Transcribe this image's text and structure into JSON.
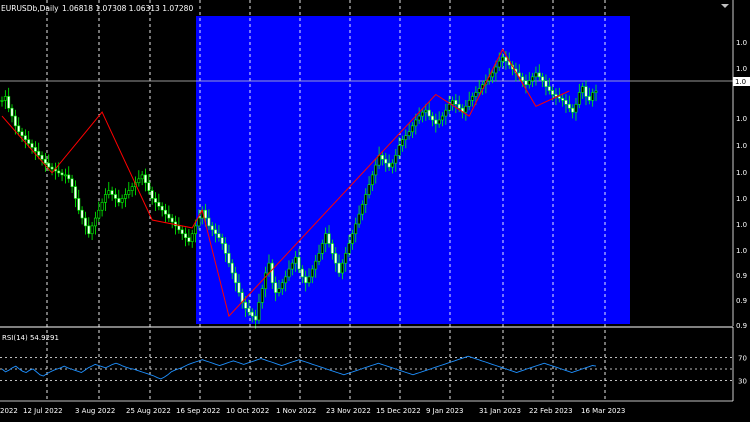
{
  "header": {
    "symbol_label": "EURUSDb,Daily",
    "ohlc_text": "1.06818 1.07308 1.06313 1.07280"
  },
  "indicator": {
    "label": "RSI(14) 54.9291",
    "levels": [
      70,
      50,
      30
    ]
  },
  "colors": {
    "background": "#000000",
    "candle": "#00ff00",
    "zigzag": "#ff0000",
    "selection_rect": "#0000ff",
    "rsi_line": "#1e90ff",
    "grid": "#ffffff",
    "axis_text": "#ffffff"
  },
  "chart_data": [
    {
      "type": "candlestick",
      "title": "EURUSDb,Daily",
      "x_ticks": [
        "2022",
        "12 Jul 2022",
        "3 Aug 2022",
        "25 Aug 2022",
        "16 Sep 2022",
        "10 Oct 2022",
        "1 Nov 2022",
        "23 Nov 2022",
        "15 Dec 2022",
        "9 Jan 2023",
        "31 Jan 2023",
        "22 Feb 2023",
        "16 Mar 2023"
      ],
      "close_series": [
        1.068,
        1.07,
        1.064,
        1.06,
        1.055,
        1.052,
        1.05,
        1.048,
        1.046,
        1.044,
        1.042,
        1.04,
        1.038,
        1.036,
        1.034,
        1.033,
        1.032,
        1.031,
        1.03,
        1.03,
        1.028,
        1.024,
        1.018,
        1.012,
        1.008,
        1.004,
        1.0,
        1.004,
        1.008,
        1.012,
        1.016,
        1.02,
        1.022,
        1.02,
        1.018,
        1.016,
        1.018,
        1.02,
        1.022,
        1.024,
        1.026,
        1.028,
        1.03,
        1.026,
        1.022,
        1.018,
        1.016,
        1.014,
        1.012,
        1.01,
        1.008,
        1.006,
        1.004,
        1.002,
        1.0,
        0.998,
        0.996,
        1.0,
        1.004,
        1.008,
        1.012,
        1.008,
        1.004,
        1.002,
        1.0,
        0.998,
        0.995,
        0.99,
        0.985,
        0.98,
        0.975,
        0.97,
        0.965,
        0.962,
        0.96,
        0.958,
        0.956,
        0.965,
        0.972,
        0.98,
        0.985,
        0.975,
        0.97,
        0.972,
        0.975,
        0.978,
        0.982,
        0.985,
        0.988,
        0.982,
        0.978,
        0.975,
        0.978,
        0.982,
        0.986,
        0.99,
        0.995,
        1.0,
        0.995,
        0.99,
        0.985,
        0.98,
        0.985,
        0.99,
        0.995,
        1.0,
        1.005,
        1.01,
        1.015,
        1.02,
        1.025,
        1.03,
        1.035,
        1.04,
        1.038,
        1.036,
        1.034,
        1.036,
        1.04,
        1.045,
        1.048,
        1.05,
        1.052,
        1.055,
        1.058,
        1.06,
        1.062,
        1.063,
        1.06,
        1.058,
        1.056,
        1.058,
        1.06,
        1.063,
        1.066,
        1.068,
        1.066,
        1.064,
        1.062,
        1.065,
        1.068,
        1.07,
        1.072,
        1.074,
        1.076,
        1.078,
        1.08,
        1.082,
        1.085,
        1.088,
        1.09,
        1.088,
        1.086,
        1.084,
        1.082,
        1.08,
        1.078,
        1.076,
        1.078,
        1.08,
        1.082,
        1.08,
        1.078,
        1.075,
        1.073,
        1.071,
        1.07,
        1.069,
        1.068,
        1.066,
        1.064,
        1.062,
        1.066,
        1.072,
        1.075,
        1.07,
        1.068,
        1.072,
        1.0728
      ],
      "zigzag_points": [
        [
          0,
          1.06
        ],
        [
          15,
          1.031
        ],
        [
          30,
          1.062
        ],
        [
          45,
          1.007
        ],
        [
          57,
          1.003
        ],
        [
          60,
          1.012
        ],
        [
          68,
          0.958
        ],
        [
          130,
          1.071
        ],
        [
          140,
          1.06
        ],
        [
          150,
          1.094
        ],
        [
          160,
          1.065
        ],
        [
          170,
          1.0728
        ]
      ],
      "indicator_series": [
        50,
        45,
        48,
        52,
        55,
        50,
        46,
        44,
        48,
        50,
        45,
        40,
        38,
        42,
        45,
        48,
        50,
        52,
        55,
        52,
        50,
        48,
        46,
        44,
        48,
        52,
        55,
        58,
        56,
        54,
        52,
        55,
        58,
        60,
        58,
        55,
        53,
        51,
        50,
        48,
        46,
        44,
        42,
        40,
        38,
        35,
        33,
        36,
        40,
        45,
        48,
        50,
        52,
        55,
        58,
        60,
        62,
        64,
        66,
        64,
        62,
        60,
        58,
        56,
        58,
        60,
        62,
        64,
        62,
        60,
        58,
        60,
        62,
        64,
        66,
        68,
        66,
        64,
        62,
        60,
        58,
        56,
        58,
        60,
        62,
        64,
        66,
        64,
        62,
        60,
        58,
        56,
        54,
        52,
        50,
        48,
        46,
        44,
        42,
        40,
        42,
        44,
        46,
        48,
        50,
        52,
        54,
        56,
        58,
        60,
        58,
        56,
        54,
        52,
        50,
        48,
        46,
        44,
        42,
        40,
        42,
        44,
        46,
        48,
        50,
        52,
        54,
        56,
        58,
        60,
        62,
        64,
        66,
        68,
        70,
        72,
        70,
        68,
        66,
        64,
        62,
        60,
        58,
        56,
        54,
        52,
        50,
        48,
        46,
        44,
        46,
        48,
        50,
        52,
        54,
        56,
        58,
        60,
        58,
        56,
        54,
        52,
        50,
        48,
        46,
        44,
        46,
        48,
        50,
        52,
        54,
        56,
        54.9291
      ],
      "ylim": [
        0.955,
        1.11
      ],
      "rsi_ylim": [
        0,
        100
      ]
    }
  ]
}
